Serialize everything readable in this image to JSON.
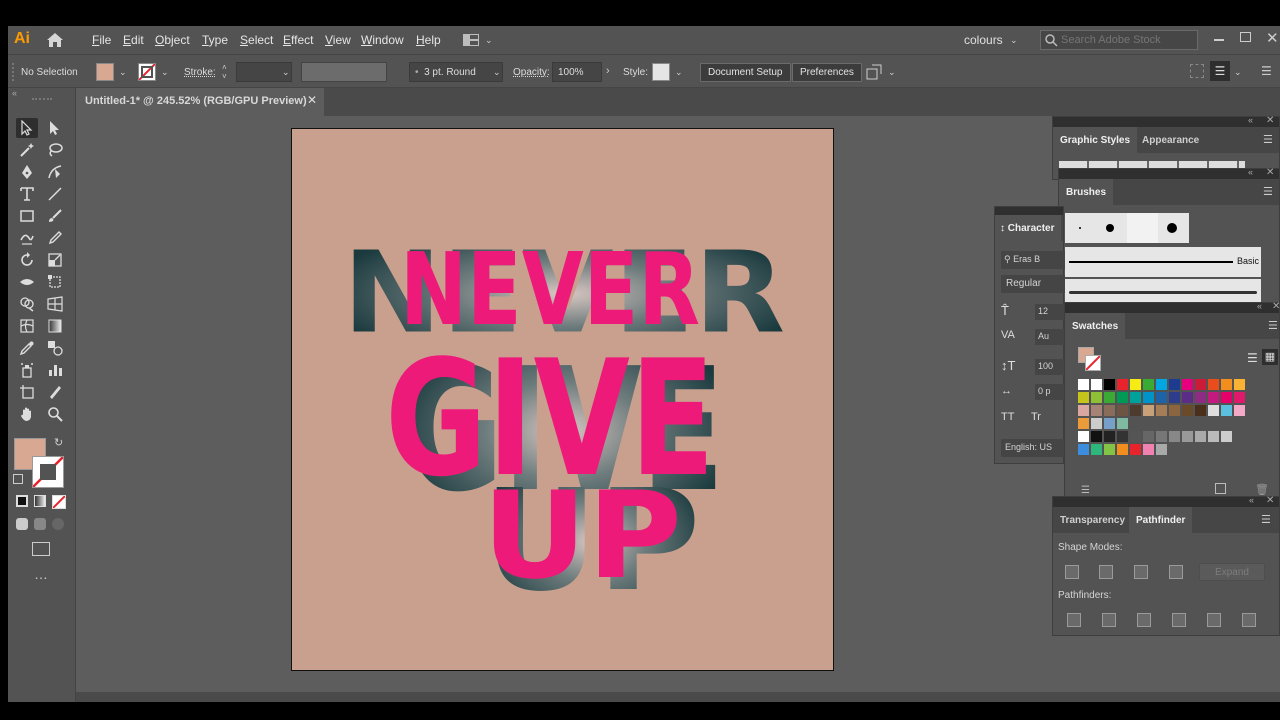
{
  "app": {
    "logo": "Ai"
  },
  "menu": [
    "File",
    "Edit",
    "Object",
    "Type",
    "Select",
    "Effect",
    "View",
    "Window",
    "Help"
  ],
  "workspace": {
    "label": "colours"
  },
  "search": {
    "placeholder": "Search Adobe Stock"
  },
  "control": {
    "selection": "No Selection",
    "stroke_label": "Stroke:",
    "brush": "3 pt. Round",
    "opacity_label": "Opacity:",
    "opacity_value": "100%",
    "style_label": "Style:",
    "document_setup": "Document Setup",
    "preferences": "Preferences",
    "fill_color": "#d8a893"
  },
  "document": {
    "tab_title": "Untitled-1* @ 245.52% (RGB/GPU Preview)"
  },
  "artwork": {
    "background_color": "#c9a08e",
    "text_color": "#ee1a7a",
    "lines": [
      "NEVER",
      "GIVE",
      "UP"
    ]
  },
  "panels": {
    "graphic_styles": {
      "tabs": [
        "Graphic Styles",
        "Appearance"
      ]
    },
    "brushes": {
      "title": "Brushes",
      "basic_label": "Basic"
    },
    "character": {
      "title": "Character",
      "font": "Eras B",
      "style": "Regular",
      "size": "12",
      "tracking": "Au",
      "leading": "100",
      "kerning": "0 p",
      "language": "English: US"
    },
    "swatches": {
      "title": "Swatches"
    },
    "pathfinder": {
      "tabs": [
        "Transparency",
        "Pathfinder"
      ],
      "shape_modes": "Shape Modes:",
      "expand": "Expand",
      "pathfinders": "Pathfinders:"
    }
  },
  "swatch_rows": [
    [
      "#ffffff",
      "#ffffff",
      "#000000",
      "#e8232b",
      "#f6eb14",
      "#3aaa35",
      "#00a7e1",
      "#1d3c8f",
      "#e6007e",
      "#cc1b38",
      "#e84d1b",
      "#f28e1e",
      "#f9b233"
    ],
    [
      "#c5c51c",
      "#8fbe37",
      "#3aaa35",
      "#009a56",
      "#00a19a",
      "#0094c8",
      "#1e62a8",
      "#2e3c8c",
      "#5c2d86",
      "#8e2c84",
      "#c4197f",
      "#e5006c",
      "#e1196b"
    ],
    [
      "#d9a7a0",
      "#a68374",
      "#8a6c5a",
      "#6e5442",
      "#4d3c2d",
      "#c8a179",
      "#a57e58",
      "#8a6540",
      "#6b4a2a",
      "#4a301a",
      "#dddddd",
      "#5bc0de",
      "#f4a9c8"
    ],
    [
      "#ec9b3a",
      "#cccccc",
      "#77a0c9",
      "#7fb9a1"
    ],
    [
      "#ffffff",
      "#111111",
      "#222222",
      "#333333",
      "#555555",
      "#666666",
      "#777777",
      "#888888",
      "#999999",
      "#aaaaaa",
      "#bbbbbb",
      "#cccccc"
    ],
    [
      "#3c8dde",
      "#2eb67d",
      "#84c445",
      "#f28e1e",
      "#e8232b",
      "#f081b0",
      "#a9a9a9"
    ]
  ]
}
